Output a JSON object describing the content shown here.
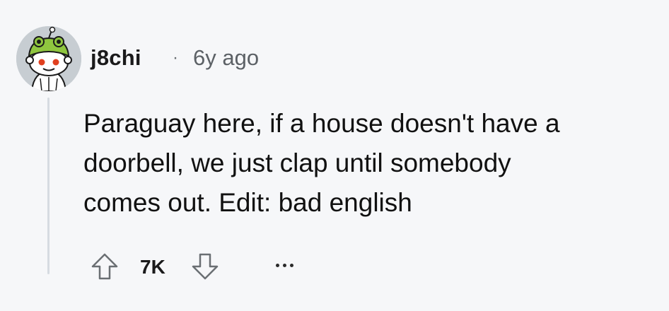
{
  "comment": {
    "username": "j8chi",
    "separator": "·",
    "timestamp": "6y ago",
    "body_lines": [
      "Paraguay here, if a house doesn't have a",
      "doorbell, we just clap until somebody",
      "comes out. Edit: bad english"
    ],
    "avatar_icon": "snoo-frog-hat-avatar",
    "actions": {
      "upvote_icon": "upvote-arrow-icon",
      "vote_count": "7K",
      "downvote_icon": "downvote-arrow-icon",
      "more_icon": "more-options-icon"
    }
  },
  "colors": {
    "background": "#f6f7f9",
    "thread_line": "#d6dbe1",
    "avatar_hat": "#8fc63f",
    "avatar_eyes": "#e0401f"
  }
}
